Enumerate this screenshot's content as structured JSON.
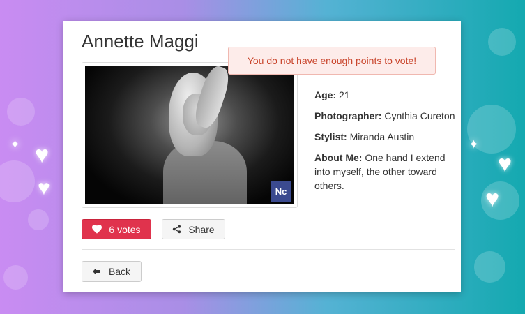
{
  "profile": {
    "name": "Annette Maggi",
    "alert": "You do not have enough points to vote!",
    "photo_watermark": "Nc",
    "details": {
      "age_label": "Age:",
      "age_value": "21",
      "photographer_label": "Photographer:",
      "photographer_value": "Cynthia Cureton",
      "stylist_label": "Stylist:",
      "stylist_value": "Miranda Austin",
      "about_label": "About Me:",
      "about_value": "One hand I extend into myself, the other toward others."
    }
  },
  "actions": {
    "votes_label": "6 votes",
    "share_label": "Share",
    "back_label": "Back"
  },
  "icons": {
    "vote": "heart-icon",
    "share": "share-icon",
    "back": "arrow-left-icon"
  },
  "colors": {
    "vote_button": "#e0334d",
    "alert_text": "#c9452c",
    "alert_bg": "#fdecea"
  }
}
